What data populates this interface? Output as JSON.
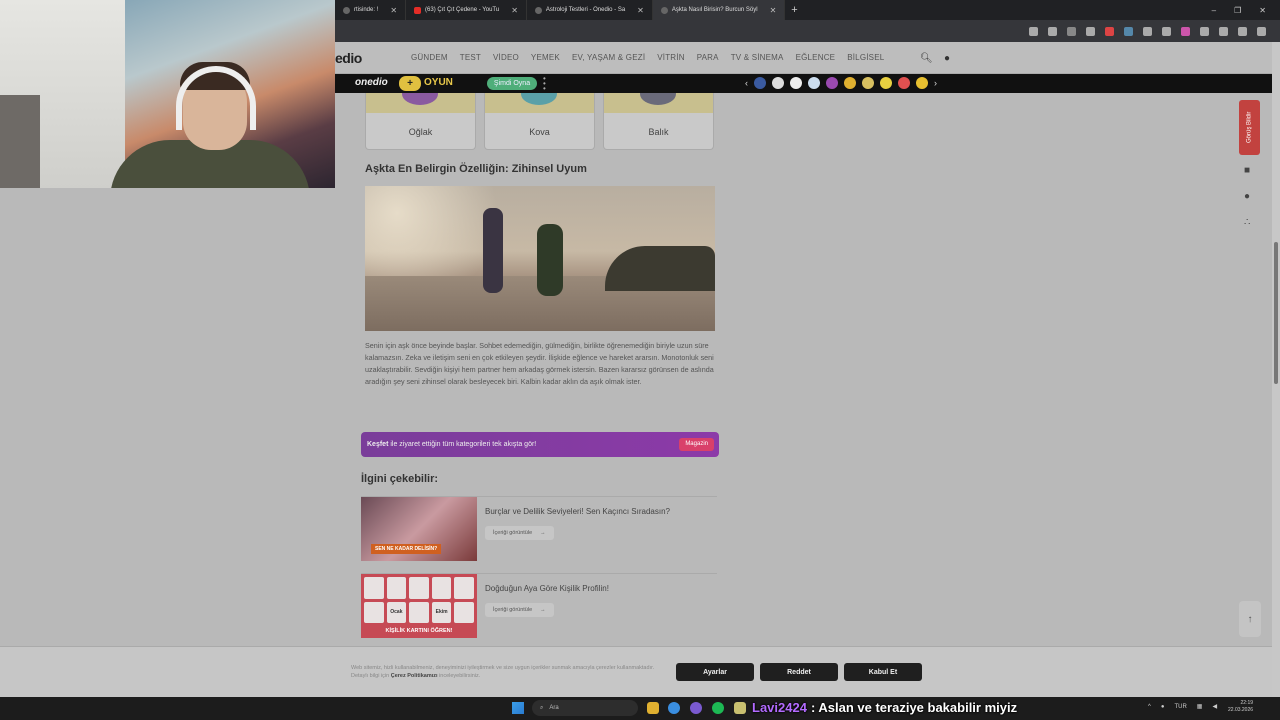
{
  "browser": {
    "tabs": [
      {
        "label": "rtisinde: !",
        "icon": "page"
      },
      {
        "label": "(63) Çıt Çıt Çedene - YouTu",
        "icon": "youtube"
      },
      {
        "label": "Astroloji Testleri - Onedio - Sa",
        "icon": "page"
      },
      {
        "label": "Aşkta Nasıl Birisin? Burcun Söyl",
        "icon": "page",
        "active": true
      }
    ]
  },
  "site": {
    "logo": "edio",
    "nav": [
      "GÜNDEM",
      "TEST",
      "VİDEO",
      "YEMEK",
      "EV, YAŞAM & GEZİ",
      "VİTRİN",
      "PARA",
      "TV & SİNEMA",
      "EĞLENCE",
      "BİLGİSEL"
    ],
    "promo": {
      "logo": "onedio",
      "plus": "+",
      "oyun": "OYUN",
      "button": "Şimdi Oyna"
    }
  },
  "zodiac_cards": [
    {
      "label": "Oğlak",
      "color": "#8a5aa0"
    },
    {
      "label": "Kova",
      "color": "#5aa0a8"
    },
    {
      "label": "Balık",
      "color": "#6a6a7a"
    }
  ],
  "article": {
    "section_title": "Aşkta En Belirgin Özelliğin: Zihinsel Uyum",
    "body": "Senin için aşk önce beyinde başlar. Sohbet edemediğin, gülmediğin, birlikte öğrenemediğin biriyle uzun süre kalamazsın. Zeka ve iletişim seni en çok etkileyen şeydir. İlişkide eğlence ve hareket ararsın. Monotonluk seni uzaklaştırabilir. Sevdiğin kişiyi hem partner hem arkadaş görmek istersin. Bazen kararsız görünsen de aslında aradığın şey seni zihinsel olarak besleyecek biri. Kalbin kadar aklın da aşık olmak ister."
  },
  "discover": {
    "bold": "Keşfet",
    "text": " ile ziyaret ettiğin tüm kategorileri tek akışta gör!",
    "badge": "Magazin"
  },
  "related": {
    "title": "İlgini çekebilir:",
    "items": [
      {
        "title": "Burçlar ve Delilik Seviyeleri! Sen Kaçıncı Sıradasın?",
        "button": "İçeriği görüntüle",
        "tag": "SEN NE KADAR DELİSİN?"
      },
      {
        "title": "Doğduğun Aya Göre Kişilik Profilin!",
        "button": "İçeriği görüntüle",
        "tag": "KİŞİLİK KARTINI ÖĞREN!",
        "grid": [
          "",
          "",
          "",
          "",
          "",
          "",
          "Ocak",
          "",
          "Ekim",
          ""
        ]
      }
    ]
  },
  "feedback": "Görüş Bildir",
  "cookie": {
    "text": "Web sitemiz, hizli kullanabilmeniz, deneyiminizi iyileştirmek ve size uygun içerikler sunmak amacıyla çerezler kullanmaktadır. Detaylı bilgi için ",
    "link": "Çerez Politikamızı",
    "suffix": " inceleyebilirsiniz.",
    "buttons": {
      "settings": "Ayarlar",
      "reject": "Reddet",
      "accept": "Kabul Et"
    }
  },
  "taskbar": {
    "search": "Ara",
    "lang": "TUR",
    "time": "22:19",
    "date": "22.03.2026"
  },
  "chat": {
    "user": "Lavi2424",
    "message": ": Aslan ve teraziye bakabilir miyiz"
  },
  "window_controls": [
    "–",
    "❐",
    "✕"
  ]
}
